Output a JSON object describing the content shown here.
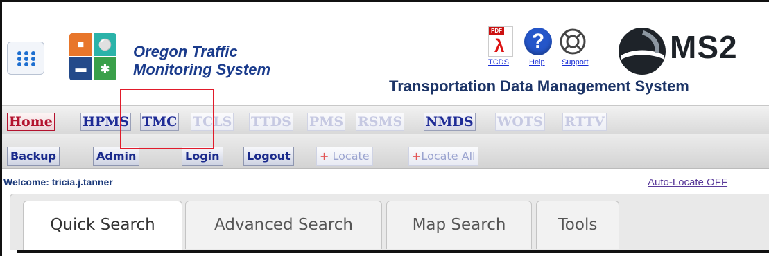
{
  "header": {
    "app_title_line1": "Oregon Traffic",
    "app_title_line2": "Monitoring System",
    "system_title": "Transportation Data Management System",
    "brand": "MS2",
    "links": {
      "pdf_tag": "PDF",
      "tcds": "TCDS",
      "help": "Help",
      "support": "Support"
    }
  },
  "modules": [
    {
      "label": "Home",
      "state": "home"
    },
    {
      "label": "HPMS",
      "state": "active"
    },
    {
      "label": "TMC",
      "state": "active"
    },
    {
      "label": "TCLS",
      "state": "disabled"
    },
    {
      "label": "TTDS",
      "state": "disabled"
    },
    {
      "label": "PMS",
      "state": "disabled"
    },
    {
      "label": "RSMS",
      "state": "disabled"
    },
    {
      "label": "NMDS",
      "state": "active"
    },
    {
      "label": "WOTS",
      "state": "disabled"
    },
    {
      "label": "RTTV",
      "state": "disabled"
    }
  ],
  "actions": {
    "backup": "Backup",
    "admin": "Admin",
    "login": "Login",
    "logout": "Logout",
    "locate": "Locate",
    "locate_all": "Locate All"
  },
  "status": {
    "welcome": "Welcome: tricia.j.tanner",
    "auto_locate": "Auto-Locate OFF"
  },
  "tabs": [
    {
      "label": "Quick Search",
      "selected": true
    },
    {
      "label": "Advanced Search",
      "selected": false
    },
    {
      "label": "Map Search",
      "selected": false
    },
    {
      "label": "Tools",
      "selected": false
    }
  ],
  "colors": {
    "accent_blue": "#1a3b8c",
    "home_red": "#b3122e",
    "highlight_box": "#e11b2b"
  }
}
